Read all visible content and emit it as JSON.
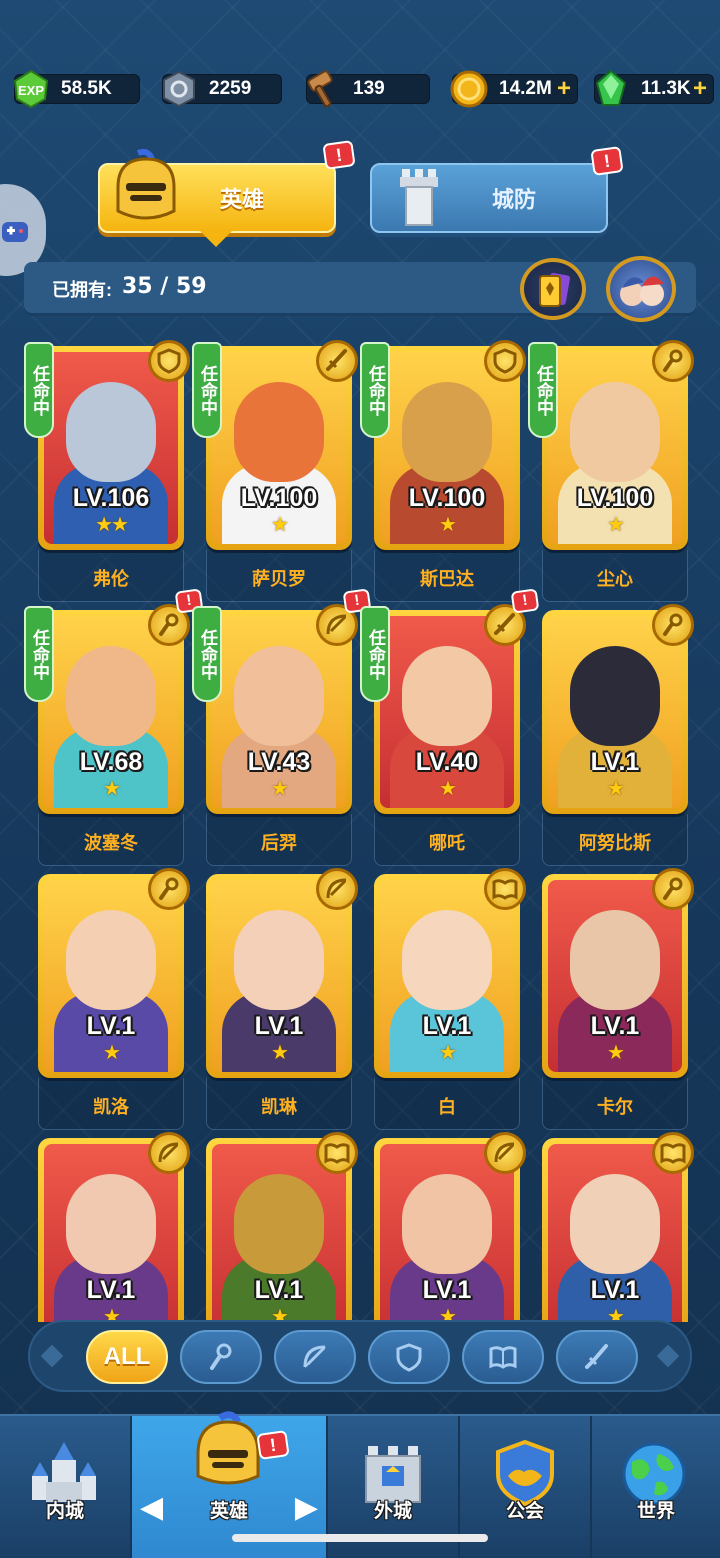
{
  "resources": [
    {
      "name": "exp",
      "value": "58.5K",
      "icon": "exp-gem-icon",
      "color": "#5ccb3a",
      "plus": false
    },
    {
      "name": "stone",
      "value": "2259",
      "icon": "stone-tablet-icon",
      "color": "#7f8fa3",
      "plus": false
    },
    {
      "name": "hammer",
      "value": "139",
      "icon": "hammer-icon",
      "color": "#c8894a",
      "plus": false
    },
    {
      "name": "gold",
      "value": "14.2M",
      "icon": "gold-coin-icon",
      "color": "#f2b51a",
      "plus": true
    },
    {
      "name": "gems",
      "value": "11.3K",
      "icon": "green-gem-icon",
      "color": "#37c44a",
      "plus": true
    }
  ],
  "plus_glyph": "+",
  "alert_glyph": "!",
  "tabs": {
    "hero": "英雄",
    "defense": "城防"
  },
  "owned": {
    "label": "已拥有:",
    "value": "35 / 59"
  },
  "heroes": [
    {
      "name": "弗伦",
      "level": "LV.106",
      "stars": "★★",
      "bg": "red",
      "cls": "shield",
      "mission": "任命中",
      "alert": false,
      "skin": "#b9c7d8",
      "outfit": "#2e5fb0"
    },
    {
      "name": "萨贝罗",
      "level": "LV.100",
      "stars": "★",
      "bg": "gold",
      "cls": "sword",
      "mission": "任命中",
      "alert": false,
      "skin": "#e8743a",
      "outfit": "#f4f4f4"
    },
    {
      "name": "斯巴达",
      "level": "LV.100",
      "stars": "★",
      "bg": "gold",
      "cls": "shield",
      "mission": "任命中",
      "alert": false,
      "skin": "#d8a04a",
      "outfit": "#b84a30"
    },
    {
      "name": "尘心",
      "level": "LV.100",
      "stars": "★",
      "bg": "gold",
      "cls": "staff",
      "mission": "任命中",
      "alert": false,
      "skin": "#f1c9a0",
      "outfit": "#f3e1b2"
    },
    {
      "name": "波塞冬",
      "level": "LV.68",
      "stars": "★",
      "bg": "gold",
      "cls": "staff",
      "mission": "任命中",
      "alert": true,
      "skin": "#f0b888",
      "outfit": "#4ec3c8"
    },
    {
      "name": "后羿",
      "level": "LV.43",
      "stars": "★",
      "bg": "gold",
      "cls": "bow",
      "mission": "任命中",
      "alert": true,
      "skin": "#f1c09a",
      "outfit": "#e3a880"
    },
    {
      "name": "哪吒",
      "level": "LV.40",
      "stars": "★",
      "bg": "red",
      "cls": "sword",
      "mission": "任命中",
      "alert": true,
      "skin": "#f3c8a5",
      "outfit": "#d9483c"
    },
    {
      "name": "阿努比斯",
      "level": "LV.1",
      "stars": "★",
      "bg": "gold",
      "cls": "staff",
      "mission": "",
      "alert": false,
      "skin": "#2b2b3a",
      "outfit": "#e2b13a"
    },
    {
      "name": "凯洛",
      "level": "LV.1",
      "stars": "★",
      "bg": "gold",
      "cls": "staff",
      "mission": "",
      "alert": false,
      "skin": "#f4cfb2",
      "outfit": "#5a4aa8"
    },
    {
      "name": "凯琳",
      "level": "LV.1",
      "stars": "★",
      "bg": "gold",
      "cls": "bow",
      "mission": "",
      "alert": false,
      "skin": "#f4d0b8",
      "outfit": "#4a3a6a"
    },
    {
      "name": "白",
      "level": "LV.1",
      "stars": "★",
      "bg": "gold",
      "cls": "book",
      "mission": "",
      "alert": false,
      "skin": "#f6d6bc",
      "outfit": "#5ac4d8"
    },
    {
      "name": "卡尔",
      "level": "LV.1",
      "stars": "★",
      "bg": "red",
      "cls": "staff",
      "mission": "",
      "alert": false,
      "skin": "#e9c6a8",
      "outfit": "#8b2a5a"
    },
    {
      "name": "",
      "level": "LV.1",
      "stars": "★",
      "bg": "red",
      "cls": "bow",
      "mission": "",
      "alert": false,
      "skin": "#f1c9b0",
      "outfit": "#6a3a8a"
    },
    {
      "name": "",
      "level": "LV.1",
      "stars": "★",
      "bg": "red",
      "cls": "book",
      "mission": "",
      "alert": false,
      "skin": "#c89a3a",
      "outfit": "#4a7a2a"
    },
    {
      "name": "",
      "level": "LV.1",
      "stars": "★",
      "bg": "red",
      "cls": "bow",
      "mission": "",
      "alert": false,
      "skin": "#f0c4a4",
      "outfit": "#6a3a8a"
    },
    {
      "name": "",
      "level": "LV.1",
      "stars": "★",
      "bg": "red",
      "cls": "book",
      "mission": "",
      "alert": false,
      "skin": "#f1d0b8",
      "outfit": "#2f5fa8"
    }
  ],
  "filters": {
    "all": "ALL",
    "items": [
      "staff",
      "bow",
      "shield",
      "book",
      "sword"
    ]
  },
  "nav": [
    {
      "label": "内城",
      "icon": "castle-icon",
      "active": false
    },
    {
      "label": "英雄",
      "icon": "helmet-icon",
      "active": true
    },
    {
      "label": "外城",
      "icon": "tower-icon",
      "active": false
    },
    {
      "label": "公会",
      "icon": "handshake-icon",
      "active": false
    },
    {
      "label": "世界",
      "icon": "globe-icon",
      "active": false
    }
  ],
  "arrows": {
    "left": "◀",
    "right": "▶"
  }
}
